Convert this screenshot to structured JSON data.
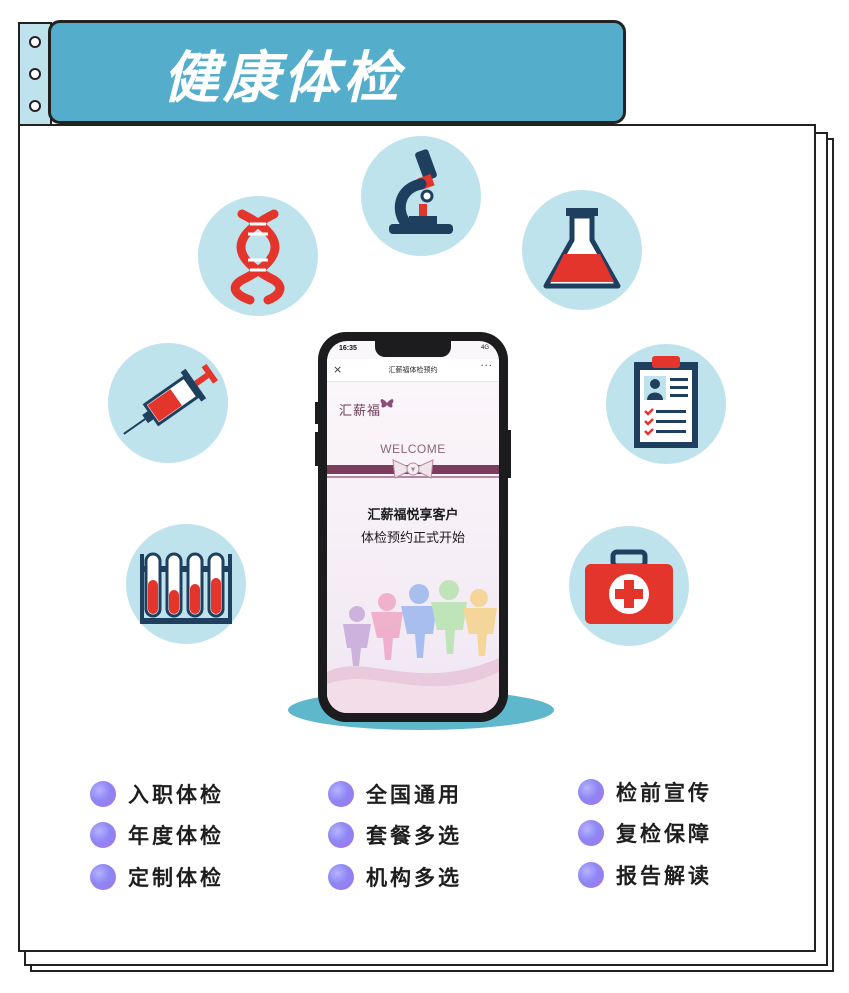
{
  "header": {
    "title": "健康体检"
  },
  "icons": [
    {
      "name": "dna-icon"
    },
    {
      "name": "microscope-icon"
    },
    {
      "name": "flask-icon"
    },
    {
      "name": "syringe-icon"
    },
    {
      "name": "medical-record-icon"
    },
    {
      "name": "test-tubes-icon"
    },
    {
      "name": "first-aid-kit-icon"
    }
  ],
  "phone": {
    "status_time": "16:35",
    "status_right": "4G",
    "nav_close": "×",
    "nav_title": "汇薪福体检预约",
    "nav_more": "···",
    "brand": "汇薪福",
    "welcome": "WELCOME",
    "promo_title": "汇薪福悦享客户",
    "promo_subtitle": "体检预约正式开始"
  },
  "features": {
    "column_1": [
      "入职体检",
      "年度体检",
      "定制体检"
    ],
    "column_2": [
      "全国通用",
      "套餐多选",
      "机构多选"
    ],
    "column_3": [
      "检前宣传",
      "复检保障",
      "报告解读"
    ]
  },
  "colors": {
    "accent": "#54aecb",
    "bubble": "#bfe3ec",
    "icon_red": "#e4352d",
    "icon_navy": "#1f3f5f",
    "feature_dot": "#8e86f4"
  }
}
